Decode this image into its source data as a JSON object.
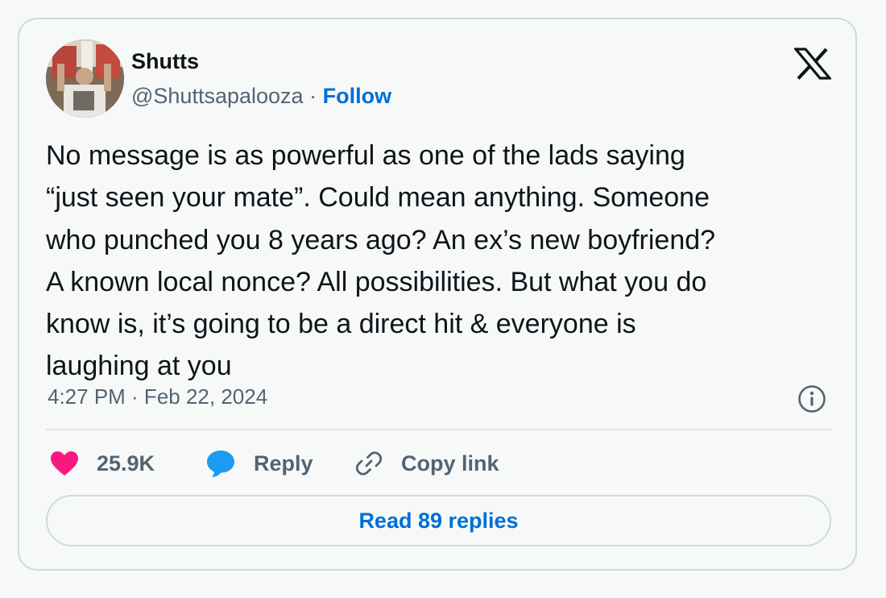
{
  "author": {
    "name": "Shutts",
    "handle": "@Shuttsapalooza",
    "separator": "·",
    "follow_label": "Follow",
    "avatar_icon": "profile-photo"
  },
  "brand": {
    "logo_icon": "x-logo-icon"
  },
  "tweet": {
    "text_lines": [
      "No message is as powerful as one of the lads saying",
      "“just seen your mate”. Could mean anything. Someone",
      "who punched you 8 years ago? An ex’s new boyfriend?",
      "A known local nonce? All possibilities. But what you do",
      "know is, it’s going to be a direct hit & everyone is",
      "laughing at you"
    ],
    "timestamp": "4:27 PM · Feb 22, 2024"
  },
  "actions": {
    "likes": "25.9K",
    "reply_label": "Reply",
    "copy_label": "Copy link"
  },
  "read_replies_label": "Read 89 replies",
  "colors": {
    "like": "#f91880",
    "reply": "#1d9bf0",
    "link": "#006fd6",
    "text": "#0f1419",
    "muted": "#536471",
    "border": "#cfd9de"
  }
}
